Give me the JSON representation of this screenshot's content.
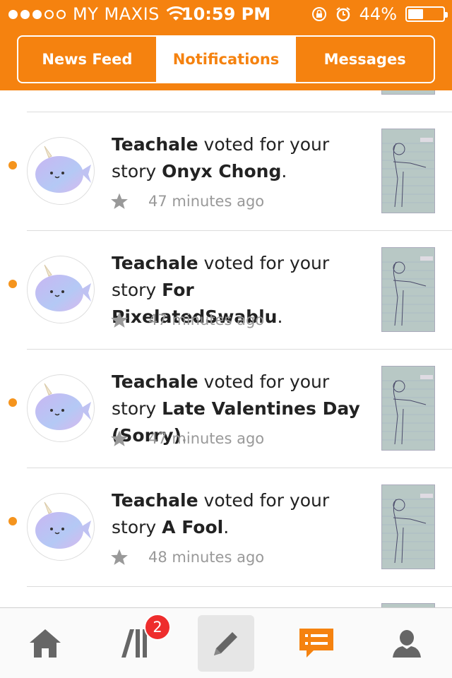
{
  "status_bar": {
    "carrier": "MY MAXIS",
    "time": "10:59 PM",
    "battery": "44%",
    "battery_level": 0.44
  },
  "tabs": [
    {
      "label": "News Feed",
      "active": false
    },
    {
      "label": "Notifications",
      "active": true
    },
    {
      "label": "Messages",
      "active": false
    }
  ],
  "notifications": [
    {
      "user": "Teachale",
      "action": "voted for your story",
      "story": "Onyx Chong",
      "time": "47 minutes ago"
    },
    {
      "user": "Teachale",
      "action": "voted for your story",
      "story": "For PixelatedSwablu",
      "time": "47 minutes ago"
    },
    {
      "user": "Teachale",
      "action": "voted for your story",
      "story": "Late Valentines Day (Sorry)",
      "time": "47 minutes ago"
    },
    {
      "user": "Teachale",
      "action": "voted for your story",
      "story": "A Fool",
      "time": "48 minutes ago"
    }
  ],
  "bottom_nav": {
    "library_badge": "2"
  },
  "colors": {
    "brand": "#f5820f",
    "unread": "#f5941d",
    "badge": "#ee2d2d"
  },
  "icons": [
    "wifi-icon",
    "orientation-lock-icon",
    "alarm-icon",
    "battery-icon",
    "star-icon",
    "home-icon",
    "library-icon",
    "pencil-icon",
    "notifications-icon",
    "profile-icon"
  ]
}
